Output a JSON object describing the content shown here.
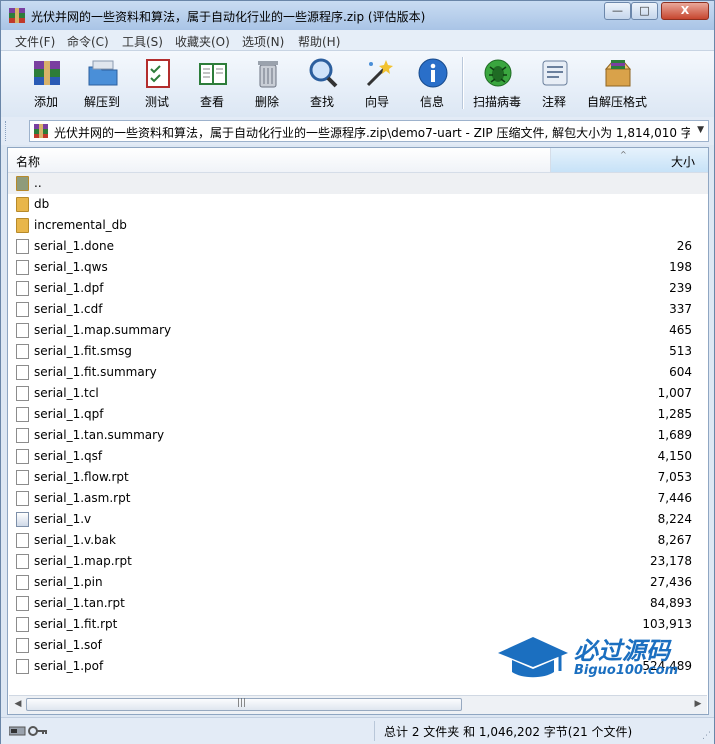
{
  "window": {
    "title": "光伏并网的一些资料和算法，属于自动化行业的一些源程序.zip (评估版本)",
    "minimize": "—",
    "maximize": "□",
    "close": "X"
  },
  "menu": [
    "文件(F)",
    "命令(C)",
    "工具(S)",
    "收藏夹(O)",
    "选项(N)",
    "帮助(H)"
  ],
  "toolbar": [
    {
      "label": "添加",
      "icon": "add-archive-icon"
    },
    {
      "label": "解压到",
      "icon": "extract-to-icon"
    },
    {
      "label": "测试",
      "icon": "test-icon"
    },
    {
      "label": "查看",
      "icon": "view-icon"
    },
    {
      "label": "删除",
      "icon": "delete-icon"
    },
    {
      "label": "查找",
      "icon": "find-icon"
    },
    {
      "label": "向导",
      "icon": "wizard-icon"
    },
    {
      "label": "信息",
      "icon": "info-icon"
    },
    {
      "label": "扫描病毒",
      "icon": "virus-scan-icon"
    },
    {
      "label": "注释",
      "icon": "comment-icon"
    },
    {
      "label": "自解压格式",
      "icon": "sfx-icon"
    }
  ],
  "address": {
    "path": "光伏并网的一些资料和算法，属于自动化行业的一些源程序.zip\\demo7-uart - ZIP 压缩文件, 解包大小为 1,814,010 字节"
  },
  "columns": {
    "name": "名称",
    "size": "大小"
  },
  "rows": [
    {
      "name": "..",
      "size": "",
      "type": "parent"
    },
    {
      "name": "db",
      "size": "",
      "type": "folder"
    },
    {
      "name": "incremental_db",
      "size": "",
      "type": "folder"
    },
    {
      "name": "serial_1.done",
      "size": "26",
      "type": "file"
    },
    {
      "name": "serial_1.qws",
      "size": "198",
      "type": "file"
    },
    {
      "name": "serial_1.dpf",
      "size": "239",
      "type": "file"
    },
    {
      "name": "serial_1.cdf",
      "size": "337",
      "type": "file"
    },
    {
      "name": "serial_1.map.summary",
      "size": "465",
      "type": "file"
    },
    {
      "name": "serial_1.fit.smsg",
      "size": "513",
      "type": "file"
    },
    {
      "name": "serial_1.fit.summary",
      "size": "604",
      "type": "file"
    },
    {
      "name": "serial_1.tcl",
      "size": "1,007",
      "type": "file"
    },
    {
      "name": "serial_1.qpf",
      "size": "1,285",
      "type": "file"
    },
    {
      "name": "serial_1.tan.summary",
      "size": "1,689",
      "type": "file"
    },
    {
      "name": "serial_1.qsf",
      "size": "4,150",
      "type": "file"
    },
    {
      "name": "serial_1.flow.rpt",
      "size": "7,053",
      "type": "file"
    },
    {
      "name": "serial_1.asm.rpt",
      "size": "7,446",
      "type": "file"
    },
    {
      "name": "serial_1.v",
      "size": "8,224",
      "type": "vfile"
    },
    {
      "name": "serial_1.v.bak",
      "size": "8,267",
      "type": "file"
    },
    {
      "name": "serial_1.map.rpt",
      "size": "23,178",
      "type": "file"
    },
    {
      "name": "serial_1.pin",
      "size": "27,436",
      "type": "file"
    },
    {
      "name": "serial_1.tan.rpt",
      "size": "84,893",
      "type": "file"
    },
    {
      "name": "serial_1.fit.rpt",
      "size": "103,913",
      "type": "file"
    },
    {
      "name": "serial_1.sof",
      "size": "",
      "type": "file"
    },
    {
      "name": "serial_1.pof",
      "size": "524,489",
      "type": "file"
    }
  ],
  "scrollbar": {
    "thumb_grip": "|||"
  },
  "status": {
    "text": "总计 2 文件夹 和 1,046,202 字节(21 个文件)"
  },
  "watermark": {
    "cn": "必过源码",
    "en": "Biguo100.com"
  },
  "colors": {
    "accent": "#1b6fc0",
    "folder": "#e8b64a",
    "title_bg": "#b9d1ee"
  }
}
